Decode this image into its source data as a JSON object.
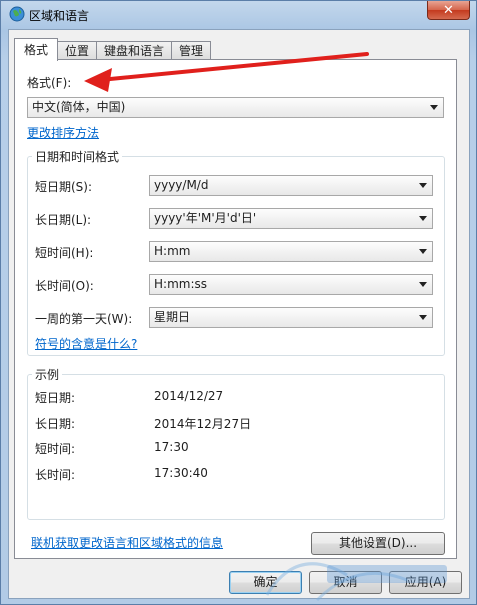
{
  "window": {
    "title": "区域和语言",
    "close_glyph": "✕"
  },
  "tabs": [
    {
      "label": "格式"
    },
    {
      "label": "位置"
    },
    {
      "label": "键盘和语言"
    },
    {
      "label": "管理"
    }
  ],
  "format": {
    "label": "格式(F):",
    "value": "中文(简体，中国)",
    "change_sort_link": "更改排序方法"
  },
  "datetime_group": {
    "title": "日期和时间格式",
    "rows": [
      {
        "label": "短日期(S):",
        "value": "yyyy/M/d"
      },
      {
        "label": "长日期(L):",
        "value": "yyyy'年'M'月'd'日'"
      },
      {
        "label": "短时间(H):",
        "value": "H:mm"
      },
      {
        "label": "长时间(O):",
        "value": "H:mm:ss"
      },
      {
        "label": "一周的第一天(W):",
        "value": "星期日"
      }
    ],
    "symbols_link": "符号的含意是什么?"
  },
  "example_group": {
    "title": "示例",
    "rows": [
      {
        "label": "短日期:",
        "value": "2014/12/27"
      },
      {
        "label": "长日期:",
        "value": "2014年12月27日"
      },
      {
        "label": "短时间:",
        "value": "17:30"
      },
      {
        "label": "长时间:",
        "value": "17:30:40"
      }
    ]
  },
  "other_settings_button": "其他设置(D)...",
  "online_link": "联机获取更改语言和区域格式的信息",
  "footer": {
    "ok": "确定",
    "cancel": "取消",
    "apply": "应用(A)"
  },
  "colors": {
    "annotation_arrow": "#e0201c",
    "link": "#0066cc"
  }
}
